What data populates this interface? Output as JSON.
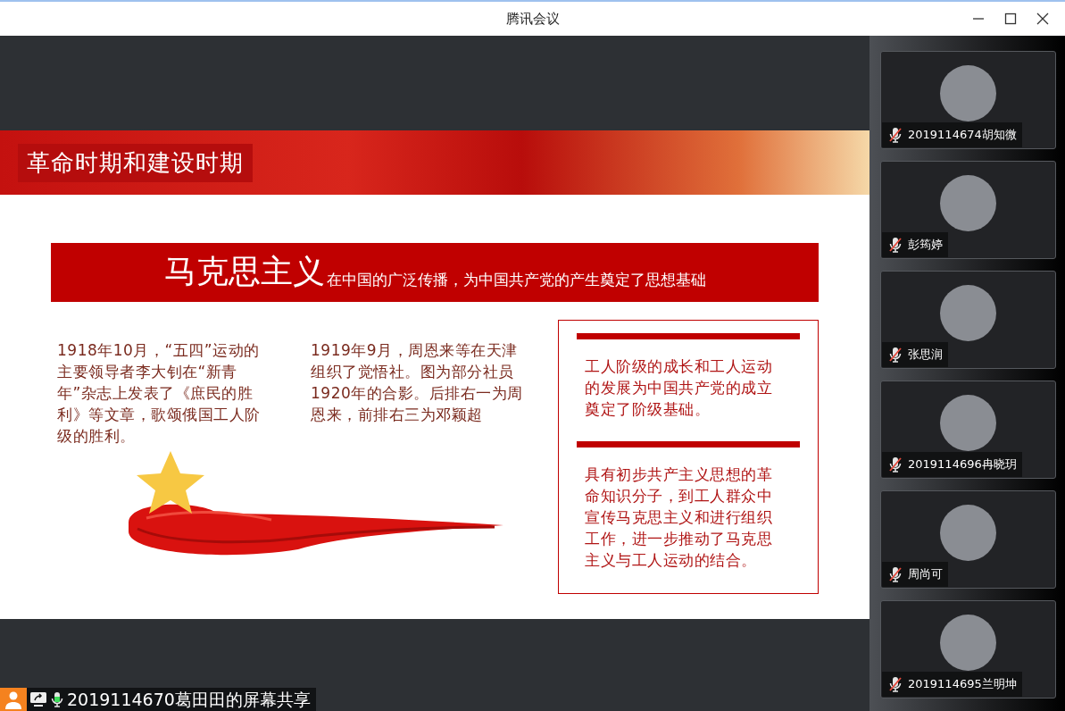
{
  "window": {
    "title": "腾讯会议"
  },
  "slide": {
    "banner_title": "革命时期和建设时期",
    "heading": {
      "main": "马克思主义",
      "rest": "在中国的广泛传播，为中国共产党的产生奠定了思想基础"
    },
    "columns": [
      "1918年10月，“五四”运动的主要领导者李大钊在“新青年”杂志上发表了《庶民的胜利》等文章，歌颂俄国工人阶级的胜利。",
      "1919年9月，周恩来等在天津组织了觉悟社。图为部分社员1920年的合影。后排右一为周恩来，前排右三为邓颖超"
    ],
    "box_sections": [
      "工人阶级的成长和工人运动的发展为中国共产党的成立奠定了阶级基础。",
      "具有初步共产主义思想的革命知识分子，到工人群众中宣传马克思主义和进行组织工作，进一步推动了马克思主义与工人运动的结合。"
    ]
  },
  "share_bar": {
    "label": "2019114670葛田田的屏幕共享",
    "mic_active": true
  },
  "participants": [
    {
      "name": "2019114674胡知微",
      "muted": true
    },
    {
      "name": "彭筠婷",
      "muted": true
    },
    {
      "name": "张思润",
      "muted": true
    },
    {
      "name": "2019114696冉晓玥",
      "muted": true
    },
    {
      "name": "周尚可",
      "muted": true
    },
    {
      "name": "2019114695兰明坤",
      "muted": true
    }
  ]
}
